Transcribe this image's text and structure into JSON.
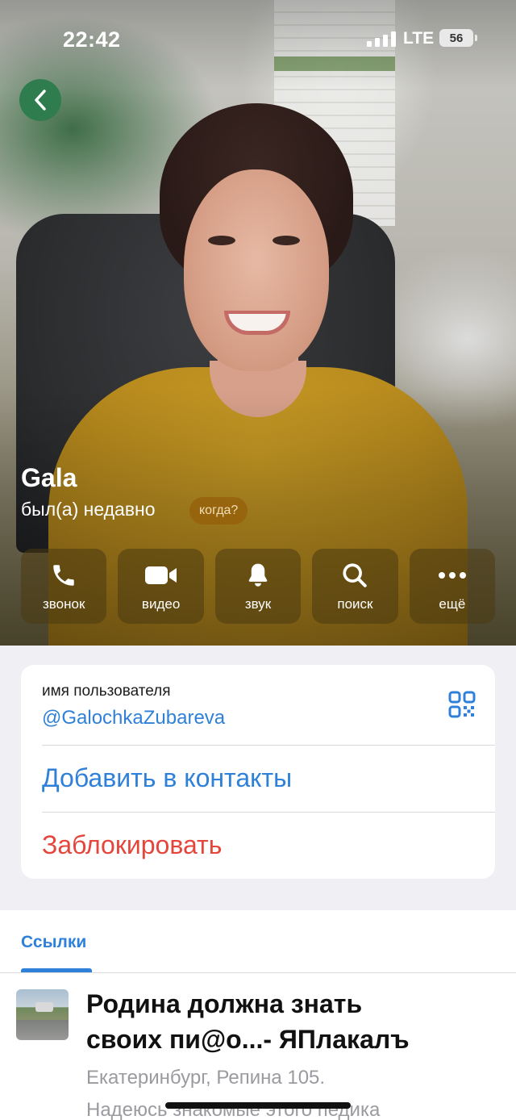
{
  "status_bar": {
    "time": "22:42",
    "network": "LTE",
    "battery": "56"
  },
  "profile": {
    "name": "Gala",
    "last_seen": "был(а) недавно",
    "when_pill": "когда?"
  },
  "actions": [
    {
      "label": "звонок",
      "icon": "phone-icon"
    },
    {
      "label": "видео",
      "icon": "video-camera-icon"
    },
    {
      "label": "звук",
      "icon": "bell-icon"
    },
    {
      "label": "поиск",
      "icon": "search-icon"
    },
    {
      "label": "ещё",
      "icon": "more-dots-icon"
    }
  ],
  "info": {
    "username_label": "имя пользователя",
    "username": "@GalochkaZubareva",
    "add_contact": "Добавить в контакты",
    "block": "Заблокировать"
  },
  "links": {
    "tab_label": "Ссылки",
    "item": {
      "title": "Родина должна знать своих пи@о...- ЯПлакалъ",
      "line1": "Екатеринбург, Репина 105.",
      "line2": "Надеюсь знакомые этого педика"
    }
  },
  "colors": {
    "accent": "#2f80d8",
    "danger": "#e5453b",
    "back_button": "#2f7d4f"
  }
}
